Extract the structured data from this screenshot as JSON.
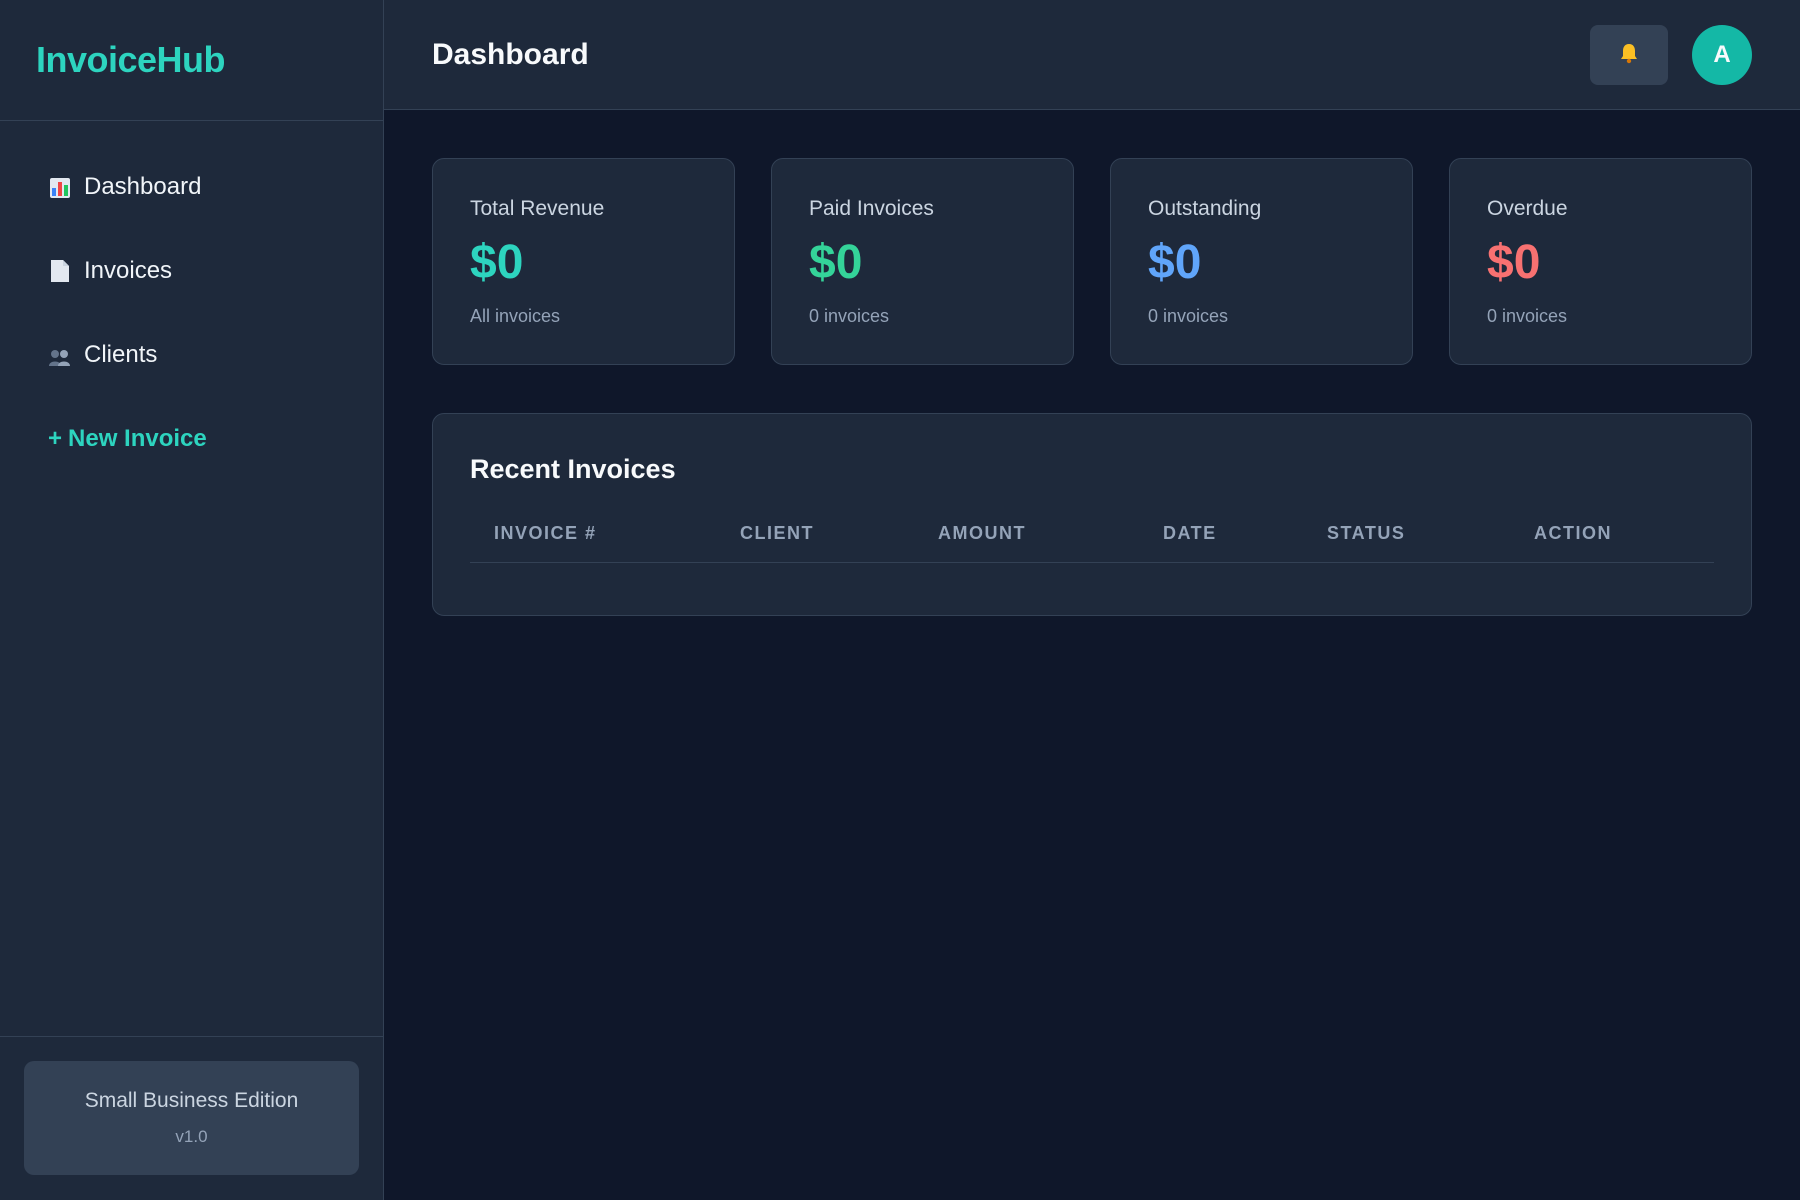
{
  "app": {
    "name": "InvoiceHub"
  },
  "sidebar": {
    "items": [
      {
        "label": "Dashboard",
        "icon": "bar-chart-icon"
      },
      {
        "label": "Invoices",
        "icon": "document-icon"
      },
      {
        "label": "Clients",
        "icon": "users-icon"
      }
    ],
    "new_invoice": {
      "plus": "+",
      "label": "New Invoice"
    },
    "footer": {
      "edition": "Small Business Edition",
      "version": "v1.0"
    }
  },
  "header": {
    "title": "Dashboard",
    "bell_icon": "bell-icon",
    "avatar_initial": "A"
  },
  "stats": [
    {
      "label": "Total Revenue",
      "value": "$0",
      "sub": "All invoices",
      "color": "#2dd4bf"
    },
    {
      "label": "Paid Invoices",
      "value": "$0",
      "sub": "0 invoices",
      "color": "#34d399"
    },
    {
      "label": "Outstanding",
      "value": "$0",
      "sub": "0 invoices",
      "color": "#60a5fa"
    },
    {
      "label": "Overdue",
      "value": "$0",
      "sub": "0 invoices",
      "color": "#f87171"
    }
  ],
  "recent": {
    "title": "Recent Invoices",
    "columns": [
      "INVOICE #",
      "CLIENT",
      "AMOUNT",
      "DATE",
      "STATUS",
      "ACTION"
    ],
    "rows": []
  },
  "colors": {
    "accent": "#2dd4bf",
    "background": "#0f172a",
    "panel": "#1e293b",
    "border": "#334155"
  }
}
